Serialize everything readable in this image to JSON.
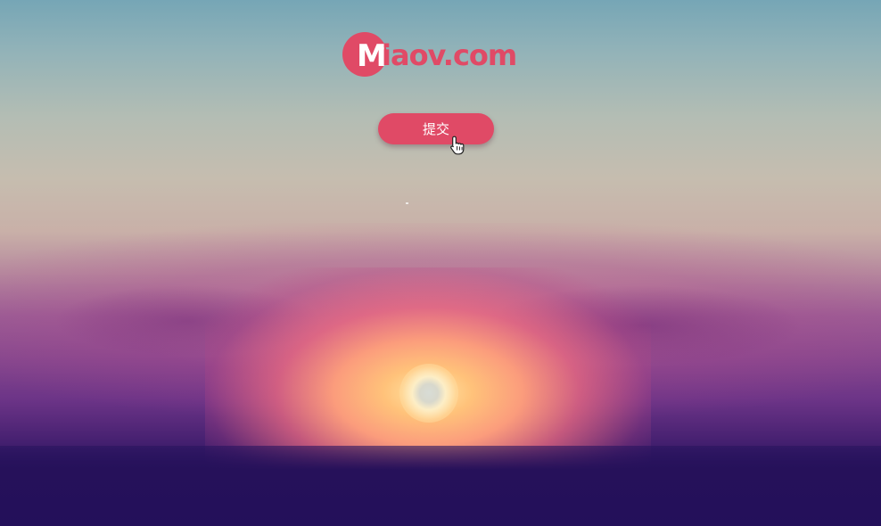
{
  "logo": {
    "initial": "M",
    "rest": "iaov.com",
    "color": "#e04a66"
  },
  "form": {
    "submit_label": "提交"
  },
  "colors": {
    "accent": "#e04a66"
  },
  "cursor": {
    "icon": "hand-pointer-icon"
  }
}
